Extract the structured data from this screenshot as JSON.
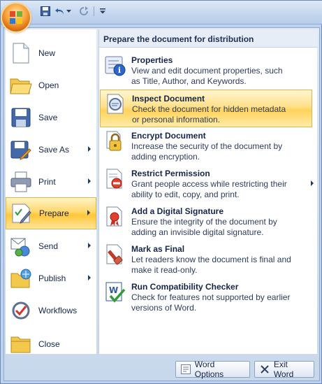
{
  "quick_access": {
    "buttons": [
      "save-icon",
      "undo-icon",
      "redo-icon",
      "customize-icon"
    ]
  },
  "left_menu": {
    "items": [
      {
        "label": "New",
        "icon": "new-document-icon",
        "has_submenu": false
      },
      {
        "label": "Open",
        "icon": "open-folder-icon",
        "has_submenu": false
      },
      {
        "label": "Save",
        "icon": "save-icon",
        "has_submenu": false
      },
      {
        "label": "Save As",
        "icon": "save-as-icon",
        "has_submenu": true
      },
      {
        "label": "Print",
        "icon": "printer-icon",
        "has_submenu": true
      },
      {
        "label": "Prepare",
        "icon": "prepare-icon",
        "has_submenu": true,
        "selected": true
      },
      {
        "label": "Send",
        "icon": "send-icon",
        "has_submenu": true
      },
      {
        "label": "Publish",
        "icon": "publish-icon",
        "has_submenu": true
      },
      {
        "label": "Workflows",
        "icon": "workflows-icon",
        "has_submenu": false
      },
      {
        "label": "Close",
        "icon": "close-folder-icon",
        "has_submenu": false
      }
    ]
  },
  "submenu": {
    "title": "Prepare the document for distribution",
    "items": [
      {
        "title": "Properties",
        "desc_1": "View and edit document properties, such",
        "desc_2": "as Title, Author, and Keywords.",
        "icon": "properties-icon"
      },
      {
        "title": "Inspect Document",
        "desc_1": "Check the document for hidden metadata",
        "desc_2": "or personal information.",
        "icon": "inspect-document-icon",
        "hot": true
      },
      {
        "title": "Encrypt Document",
        "desc_1": "Increase the security of the document by",
        "desc_2": "adding encryption.",
        "icon": "encrypt-lock-icon"
      },
      {
        "title": "Restrict Permission",
        "desc_1": "Grant people access while restricting their",
        "desc_2": "ability to edit, copy, and print.",
        "icon": "restrict-permission-icon",
        "has_submenu": true
      },
      {
        "title": "Add a Digital Signature",
        "desc_1": "Ensure the integrity of the document by",
        "desc_2": "adding an invisible digital signature.",
        "icon": "digital-signature-icon"
      },
      {
        "title": "Mark as Final",
        "desc_1": "Let readers know the document is final and",
        "desc_2": "make it read-only.",
        "icon": "mark-final-icon"
      },
      {
        "title": "Run Compatibility Checker",
        "desc_1": "Check for features not supported by earlier",
        "desc_2": "versions of Word.",
        "icon": "compatibility-checker-icon"
      }
    ]
  },
  "footer": {
    "word_options": "Word Options",
    "exit_word": "Exit Word"
  }
}
